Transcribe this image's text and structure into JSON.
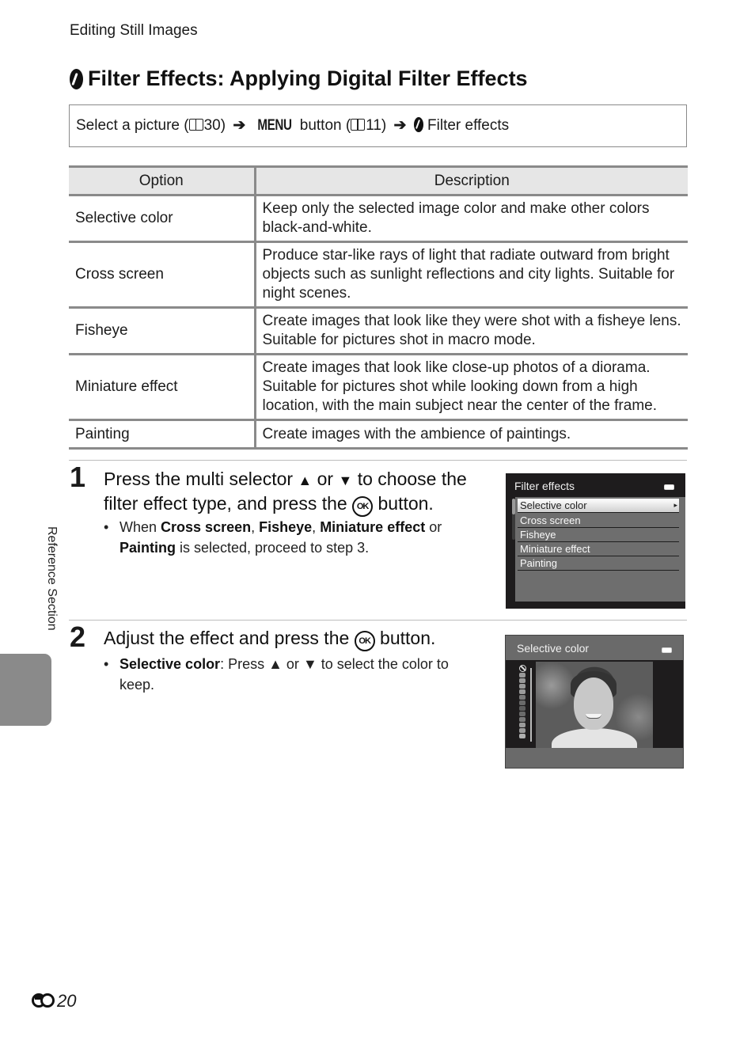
{
  "running_head": "Editing Still Images",
  "title": {
    "icon": "filter-effects-icon",
    "text": "Filter Effects: Applying Digital Filter Effects"
  },
  "nav_path": {
    "step1": "Select a picture (",
    "step1_page": "30)",
    "menu_label": "MENU",
    "step2": " button (",
    "step2_page": "11)",
    "step3": " Filter effects"
  },
  "table": {
    "headers": [
      "Option",
      "Description"
    ],
    "rows": [
      {
        "option": "Selective color",
        "description": "Keep only the selected image color and make other colors black-and-white."
      },
      {
        "option": "Cross screen",
        "description": "Produce star-like rays of light that radiate outward from bright objects such as sunlight reflections and city lights. Suitable for night scenes."
      },
      {
        "option": "Fisheye",
        "description": "Create images that look like they were shot with a fisheye lens. Suitable for pictures shot in macro mode."
      },
      {
        "option": "Miniature effect",
        "description": "Create images that look like close-up photos of a diorama. Suitable for pictures shot while looking down from a high location, with the main subject near the center of the frame."
      },
      {
        "option": "Painting",
        "description": "Create images with the ambience of paintings."
      }
    ]
  },
  "steps": [
    {
      "number": "1",
      "text_a": "Press the multi selector ",
      "up": "▲",
      "or": " or ",
      "down": "▼",
      "text_b": " to choose the filter effect type, and press the ",
      "ok": "OK",
      "text_c": " button.",
      "bullet": {
        "when": "When ",
        "b1": "Cross screen",
        "sep1": ", ",
        "b2": "Fisheye",
        "sep2": ", ",
        "b3": "Miniature effect",
        "or": " or ",
        "b4": "Painting",
        "rest": " is selected, proceed to step 3."
      }
    },
    {
      "number": "2",
      "text_a": "Adjust the effect and press the ",
      "ok": "OK",
      "text_b": " button.",
      "bullet": {
        "b1": "Selective color",
        "text_a": ": Press ",
        "up": "▲",
        "or": " or ",
        "down": "▼",
        "text_b": " to select the color to keep."
      }
    }
  ],
  "camera_screen_1": {
    "title": "Filter effects",
    "items": [
      "Selective color",
      "Cross screen",
      "Fisheye",
      "Miniature effect",
      "Painting"
    ],
    "selected_index": 0
  },
  "camera_screen_2": {
    "title": "Selective color"
  },
  "side_section": "Reference Section",
  "page_number": "20"
}
